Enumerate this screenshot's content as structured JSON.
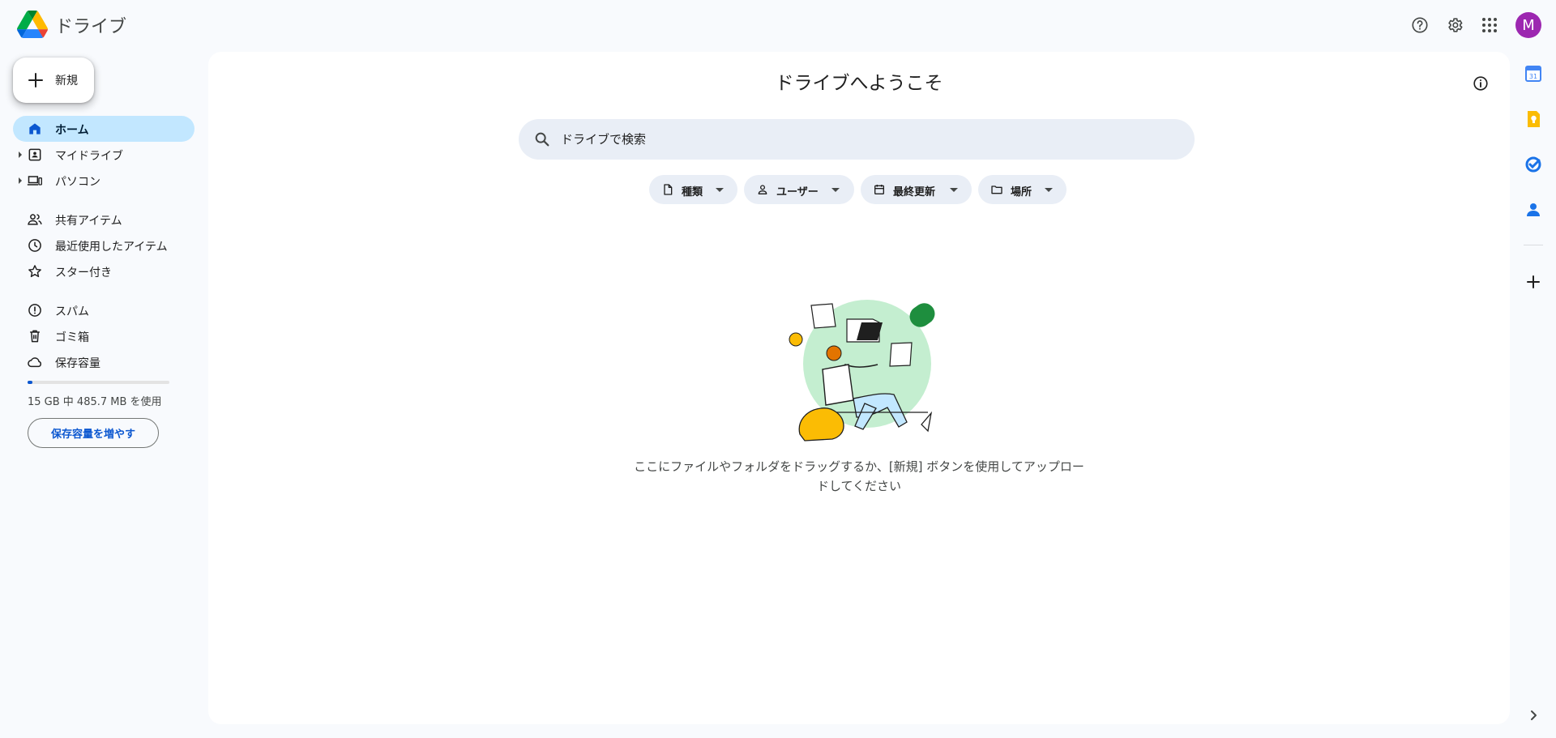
{
  "header": {
    "app_title": "ドライブ",
    "avatar_letter": "M",
    "colors": {
      "avatar": "#9c27b0"
    }
  },
  "sidebar": {
    "new_label": "新規",
    "items": [
      {
        "label": "ホーム",
        "icon": "home-icon",
        "active": true
      },
      {
        "label": "マイドライブ",
        "icon": "my-drive-icon",
        "expandable": true
      },
      {
        "label": "パソコン",
        "icon": "computers-icon",
        "expandable": true
      },
      {
        "label": "共有アイテム",
        "icon": "shared-icon"
      },
      {
        "label": "最近使用したアイテム",
        "icon": "clock-icon"
      },
      {
        "label": "スター付き",
        "icon": "star-icon"
      },
      {
        "label": "スパム",
        "icon": "spam-icon"
      },
      {
        "label": "ゴミ箱",
        "icon": "trash-icon"
      },
      {
        "label": "保存容量",
        "icon": "cloud-icon"
      }
    ],
    "storage": {
      "text": "15 GB 中 485.7 MB を使用",
      "used_fraction": 0.032,
      "button": "保存容量を増やす"
    }
  },
  "main": {
    "welcome": "ドライブへようこそ",
    "search_placeholder": "ドライブで検索",
    "filters": [
      "種類",
      "ユーザー",
      "最終更新",
      "場所"
    ],
    "empty_text": "ここにファイルやフォルダをドラッグするか、[新規] ボタンを使用してアップロードしてください"
  },
  "rail": {
    "icons": [
      "calendar-icon",
      "keep-icon",
      "tasks-icon",
      "contacts-icon",
      "add-icon",
      "chevron-right-icon"
    ],
    "calendar_day": "31"
  }
}
